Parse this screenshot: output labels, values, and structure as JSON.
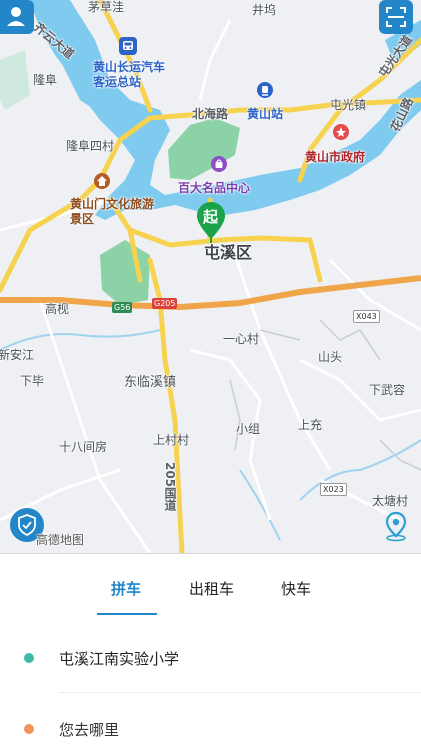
{
  "map": {
    "labels": {
      "maocaowa": "茅草洼",
      "jingwu": "井坞",
      "huizhou_ave": "齐云大道",
      "bus_station": "黄山长运汽车客运总站",
      "longfu": "隆阜",
      "beihai_rd": "北海路",
      "huangshan_station": "黄山站",
      "tunguang_town": "屯光镇",
      "tunguang_ave": "屯光大道",
      "huashan_rd": "花山路",
      "longfu_4": "隆阜四村",
      "city_gov": "黄山市政府",
      "cultural_tourism": "黄山门文化旅游景区",
      "baida": "百大名品中心",
      "tunxi_district": "屯溪区",
      "gaoqiao": "高枧",
      "xinanjiang": "新安江",
      "yixincun": "一心村",
      "shantou": "山头",
      "xiabi": "下毕",
      "donglin": "东临溪镇",
      "xiawurong": "下武容",
      "shibajianfang": "十八间房",
      "shangcun": "上村村",
      "xiaozu": "小组",
      "shangchong": "上充",
      "national_205": "205国道",
      "taitang": "太塘村",
      "gaode_logo": "高德地图"
    },
    "shields": {
      "g56": "G56",
      "g205": "G205",
      "x043": "X043",
      "x023": "X023"
    },
    "start_marker": "起",
    "colors": {
      "water": "#7ecbef",
      "park": "#8bd3a6",
      "expressway": "#f0a54a",
      "arterial": "#f6d24f",
      "accent": "#2386c8"
    },
    "icons": [
      "user-icon",
      "scan-icon",
      "location-icon",
      "shield-icon"
    ]
  },
  "panel": {
    "tabs": [
      {
        "label": "拼车",
        "active": true
      },
      {
        "label": "出租车",
        "active": false
      },
      {
        "label": "快车",
        "active": false
      }
    ],
    "from": {
      "text": "屯溪江南实验小学",
      "dot_color": "#3cbca4"
    },
    "to": {
      "placeholder": "您去哪里",
      "dot_color": "#f2955a"
    }
  }
}
